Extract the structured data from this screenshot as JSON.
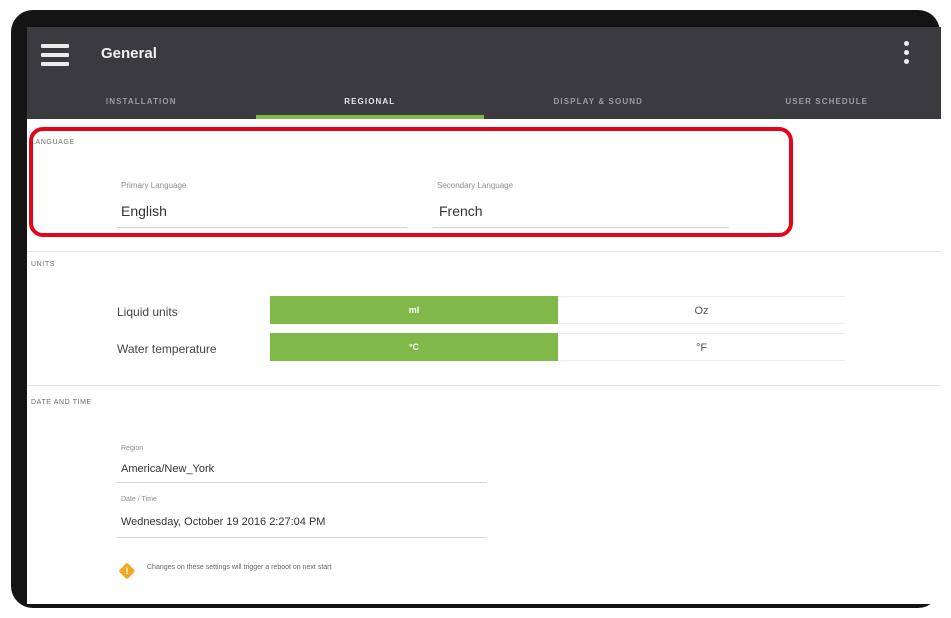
{
  "appbar": {
    "title": "General",
    "menu_icon": "hamburger-menu-icon",
    "more_icon": "more-vertical-icon",
    "background": "#3a3a3f"
  },
  "tabs": [
    {
      "label": "INSTALLATION",
      "active": false
    },
    {
      "label": "REGIONAL",
      "active": true
    },
    {
      "label": "DISPLAY & SOUND",
      "active": false
    },
    {
      "label": "USER SCHEDULE",
      "active": false
    }
  ],
  "accent_color": "#7fba48",
  "highlight_color": "#e3061b",
  "language": {
    "section_label": "LANGUAGE",
    "primary": {
      "label": "Primary Language",
      "value": "English"
    },
    "secondary": {
      "label": "Secondary Language",
      "value": "French"
    }
  },
  "units": {
    "section_label": "UNITS",
    "rows": [
      {
        "label": "Liquid units",
        "selected": "ml",
        "other": "Oz"
      },
      {
        "label": "Water temperature",
        "selected": "°C",
        "other": "°F"
      }
    ]
  },
  "datetime": {
    "section_label": "DATE AND TIME",
    "region": {
      "label": "Region",
      "value": "America/New_York"
    },
    "date_time": {
      "label": "Date / Time",
      "value": "Wednesday, October 19 2016 2:27:04 PM"
    },
    "warning_icon": "warning-icon",
    "warning_text": "Changes on these settings will trigger a reboot on next start"
  }
}
